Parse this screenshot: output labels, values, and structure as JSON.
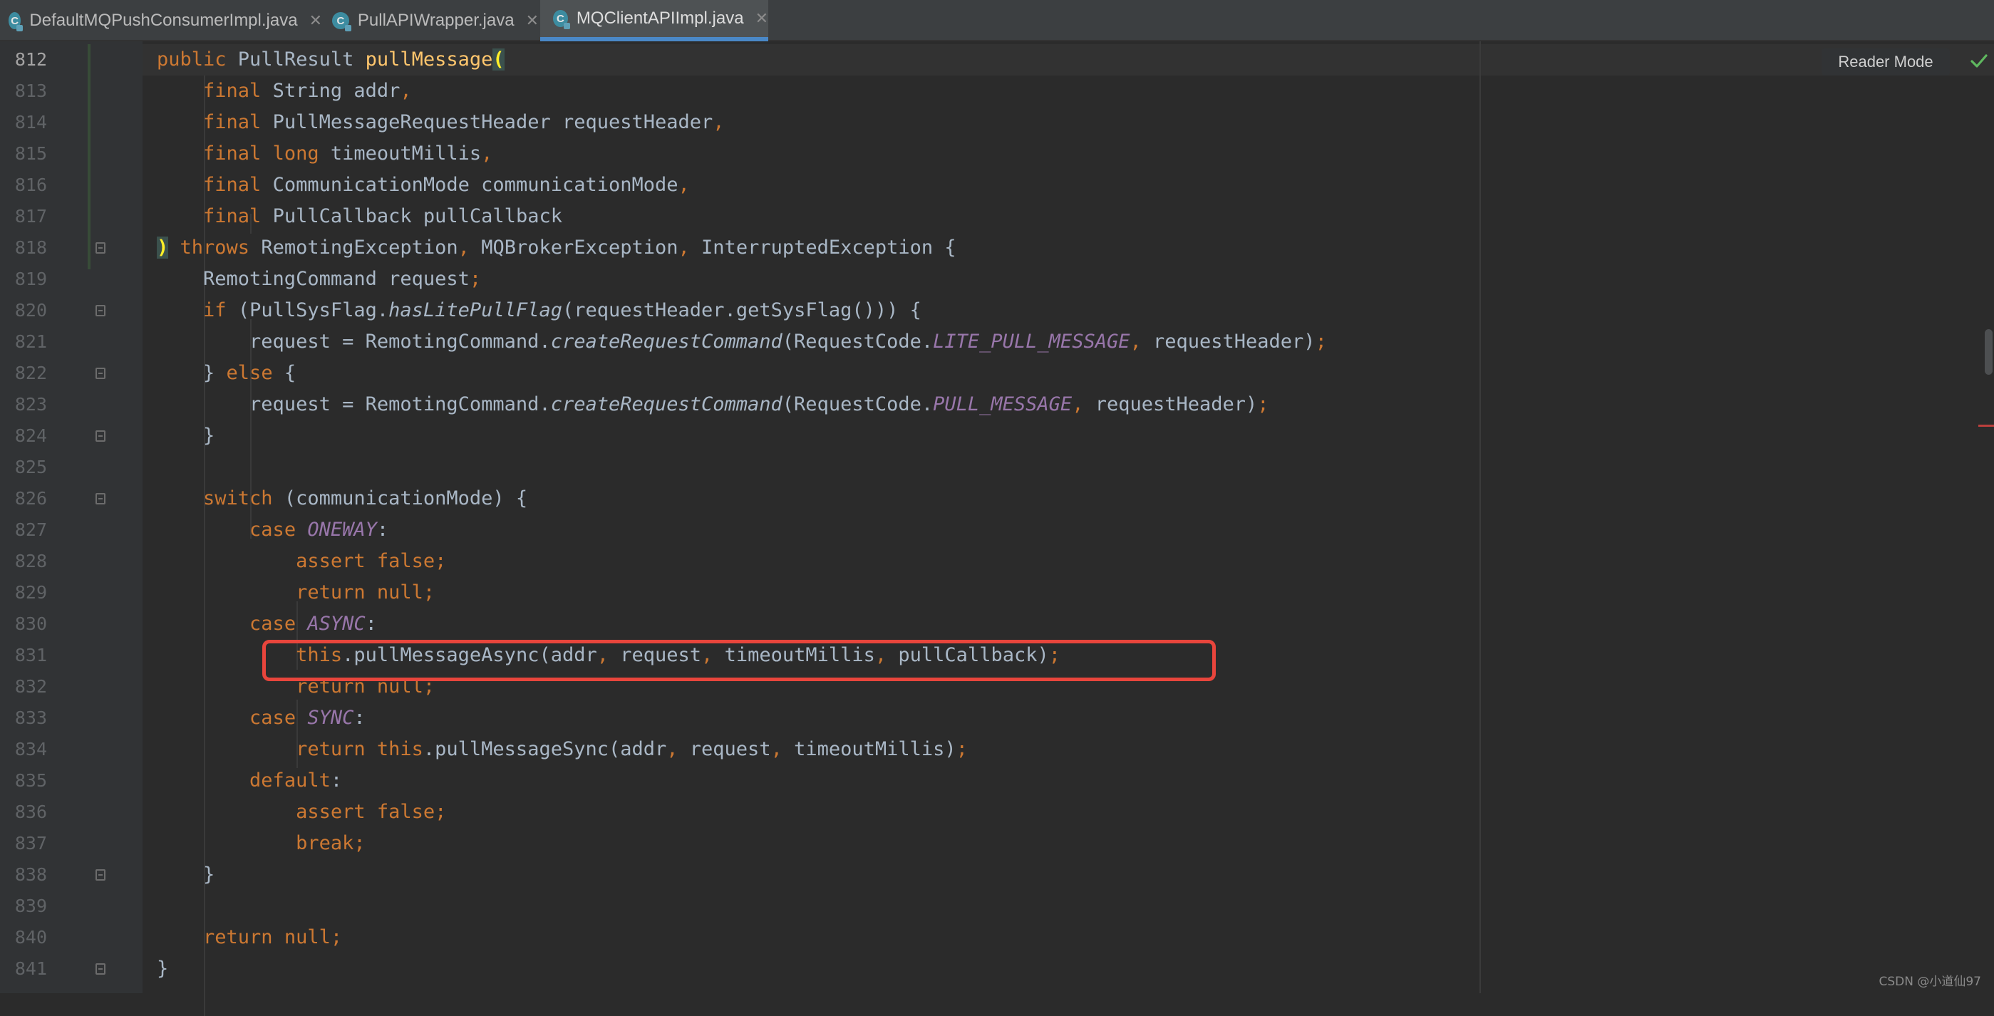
{
  "tabs": [
    {
      "label": "DefaultMQPushConsumerImpl.java",
      "icon": "class-icon",
      "active": false
    },
    {
      "label": "PullAPIWrapper.java",
      "icon": "class-icon",
      "active": false
    },
    {
      "label": "MQClientAPIImpl.java",
      "icon": "class-icon",
      "active": true
    }
  ],
  "tab_icon_letter": "C",
  "close_glyph": "✕",
  "reader_mode_label": "Reader Mode",
  "watermark": "CSDN @小道仙97",
  "current_line": 812,
  "highlighted_line": 831,
  "colors": {
    "keyword": "#cc7832",
    "method_declaration": "#ffc66d",
    "constant": "#9876aa",
    "text": "#a9b7c6",
    "highlight_box": "#e8453c",
    "check": "#5fb85f"
  },
  "code_lines": [
    {
      "num": "812",
      "tokens": [
        [
          "kw",
          "public "
        ],
        [
          "t",
          "PullResult "
        ],
        [
          "fn",
          "pullMessage"
        ],
        [
          "pm",
          "("
        ]
      ]
    },
    {
      "num": "813",
      "tokens": [
        [
          "t",
          "    "
        ],
        [
          "kw",
          "final "
        ],
        [
          "t",
          "String addr"
        ],
        [
          "kw",
          ","
        ]
      ]
    },
    {
      "num": "814",
      "tokens": [
        [
          "t",
          "    "
        ],
        [
          "kw",
          "final "
        ],
        [
          "t",
          "PullMessageRequestHeader requestHeader"
        ],
        [
          "kw",
          ","
        ]
      ]
    },
    {
      "num": "815",
      "tokens": [
        [
          "t",
          "    "
        ],
        [
          "kw",
          "final long "
        ],
        [
          "t",
          "timeoutMillis"
        ],
        [
          "kw",
          ","
        ]
      ]
    },
    {
      "num": "816",
      "tokens": [
        [
          "t",
          "    "
        ],
        [
          "kw",
          "final "
        ],
        [
          "t",
          "CommunicationMode communicationMode"
        ],
        [
          "kw",
          ","
        ]
      ]
    },
    {
      "num": "817",
      "tokens": [
        [
          "t",
          "    "
        ],
        [
          "kw",
          "final "
        ],
        [
          "t",
          "PullCallback pullCallback"
        ]
      ]
    },
    {
      "num": "818",
      "tokens": [
        [
          "pm",
          ")"
        ],
        [
          "t",
          " "
        ],
        [
          "kw",
          "throws "
        ],
        [
          "t",
          "RemotingException"
        ],
        [
          "kw",
          ", "
        ],
        [
          "t",
          "MQBrokerException"
        ],
        [
          "kw",
          ", "
        ],
        [
          "t",
          "InterruptedException {"
        ]
      ]
    },
    {
      "num": "819",
      "tokens": [
        [
          "t",
          "    RemotingCommand request"
        ],
        [
          "kw",
          ";"
        ]
      ]
    },
    {
      "num": "820",
      "tokens": [
        [
          "t",
          "    "
        ],
        [
          "kw",
          "if "
        ],
        [
          "t",
          "(PullSysFlag."
        ],
        [
          "it",
          "hasLitePullFlag"
        ],
        [
          "t",
          "(requestHeader.getSysFlag())) {"
        ]
      ]
    },
    {
      "num": "821",
      "tokens": [
        [
          "t",
          "        request = RemotingCommand."
        ],
        [
          "it",
          "createRequestCommand"
        ],
        [
          "t",
          "(RequestCode."
        ],
        [
          "cst",
          "LITE_PULL_MESSAGE"
        ],
        [
          "kw",
          ", "
        ],
        [
          "t",
          "requestHeader)"
        ],
        [
          "kw",
          ";"
        ]
      ]
    },
    {
      "num": "822",
      "tokens": [
        [
          "t",
          "    } "
        ],
        [
          "kw",
          "else "
        ],
        [
          "t",
          "{"
        ]
      ]
    },
    {
      "num": "823",
      "tokens": [
        [
          "t",
          "        request = RemotingCommand."
        ],
        [
          "it",
          "createRequestCommand"
        ],
        [
          "t",
          "(RequestCode."
        ],
        [
          "cst",
          "PULL_MESSAGE"
        ],
        [
          "kw",
          ", "
        ],
        [
          "t",
          "requestHeader)"
        ],
        [
          "kw",
          ";"
        ]
      ]
    },
    {
      "num": "824",
      "tokens": [
        [
          "t",
          "    }"
        ]
      ]
    },
    {
      "num": "825",
      "tokens": []
    },
    {
      "num": "826",
      "tokens": [
        [
          "t",
          "    "
        ],
        [
          "kw",
          "switch "
        ],
        [
          "t",
          "(communicationMode) {"
        ]
      ]
    },
    {
      "num": "827",
      "tokens": [
        [
          "t",
          "        "
        ],
        [
          "kw",
          "case "
        ],
        [
          "cst",
          "ONEWAY"
        ],
        [
          "t",
          ":"
        ]
      ]
    },
    {
      "num": "828",
      "tokens": [
        [
          "t",
          "            "
        ],
        [
          "kw",
          "assert false;"
        ]
      ]
    },
    {
      "num": "829",
      "tokens": [
        [
          "t",
          "            "
        ],
        [
          "kw",
          "return null;"
        ]
      ]
    },
    {
      "num": "830",
      "tokens": [
        [
          "t",
          "        "
        ],
        [
          "kw",
          "case "
        ],
        [
          "cst",
          "ASYNC"
        ],
        [
          "t",
          ":"
        ]
      ]
    },
    {
      "num": "831",
      "tokens": [
        [
          "t",
          "            "
        ],
        [
          "kw",
          "this"
        ],
        [
          "t",
          ".pullMessageAsync(addr"
        ],
        [
          "kw",
          ", "
        ],
        [
          "t",
          "request"
        ],
        [
          "kw",
          ", "
        ],
        [
          "t",
          "timeoutMillis"
        ],
        [
          "kw",
          ", "
        ],
        [
          "t",
          "pullCallback)"
        ],
        [
          "kw",
          ";"
        ]
      ]
    },
    {
      "num": "832",
      "tokens": [
        [
          "t",
          "            "
        ],
        [
          "kw",
          "return null;"
        ]
      ]
    },
    {
      "num": "833",
      "tokens": [
        [
          "t",
          "        "
        ],
        [
          "kw",
          "case "
        ],
        [
          "cst",
          "SYNC"
        ],
        [
          "t",
          ":"
        ]
      ]
    },
    {
      "num": "834",
      "tokens": [
        [
          "t",
          "            "
        ],
        [
          "kw",
          "return this"
        ],
        [
          "t",
          ".pullMessageSync(addr"
        ],
        [
          "kw",
          ", "
        ],
        [
          "t",
          "request"
        ],
        [
          "kw",
          ", "
        ],
        [
          "t",
          "timeoutMillis)"
        ],
        [
          "kw",
          ";"
        ]
      ]
    },
    {
      "num": "835",
      "tokens": [
        [
          "t",
          "        "
        ],
        [
          "kw",
          "default"
        ],
        [
          "t",
          ":"
        ]
      ]
    },
    {
      "num": "836",
      "tokens": [
        [
          "t",
          "            "
        ],
        [
          "kw",
          "assert false;"
        ]
      ]
    },
    {
      "num": "837",
      "tokens": [
        [
          "t",
          "            "
        ],
        [
          "kw",
          "break;"
        ]
      ]
    },
    {
      "num": "838",
      "tokens": [
        [
          "t",
          "    }"
        ]
      ]
    },
    {
      "num": "839",
      "tokens": []
    },
    {
      "num": "840",
      "tokens": [
        [
          "t",
          "    "
        ],
        [
          "kw",
          "return null;"
        ]
      ]
    },
    {
      "num": "841",
      "tokens": [
        [
          "t",
          "}"
        ]
      ]
    }
  ],
  "fold_markers_at": [
    "818",
    "820",
    "822",
    "824",
    "826",
    "838",
    "841"
  ]
}
